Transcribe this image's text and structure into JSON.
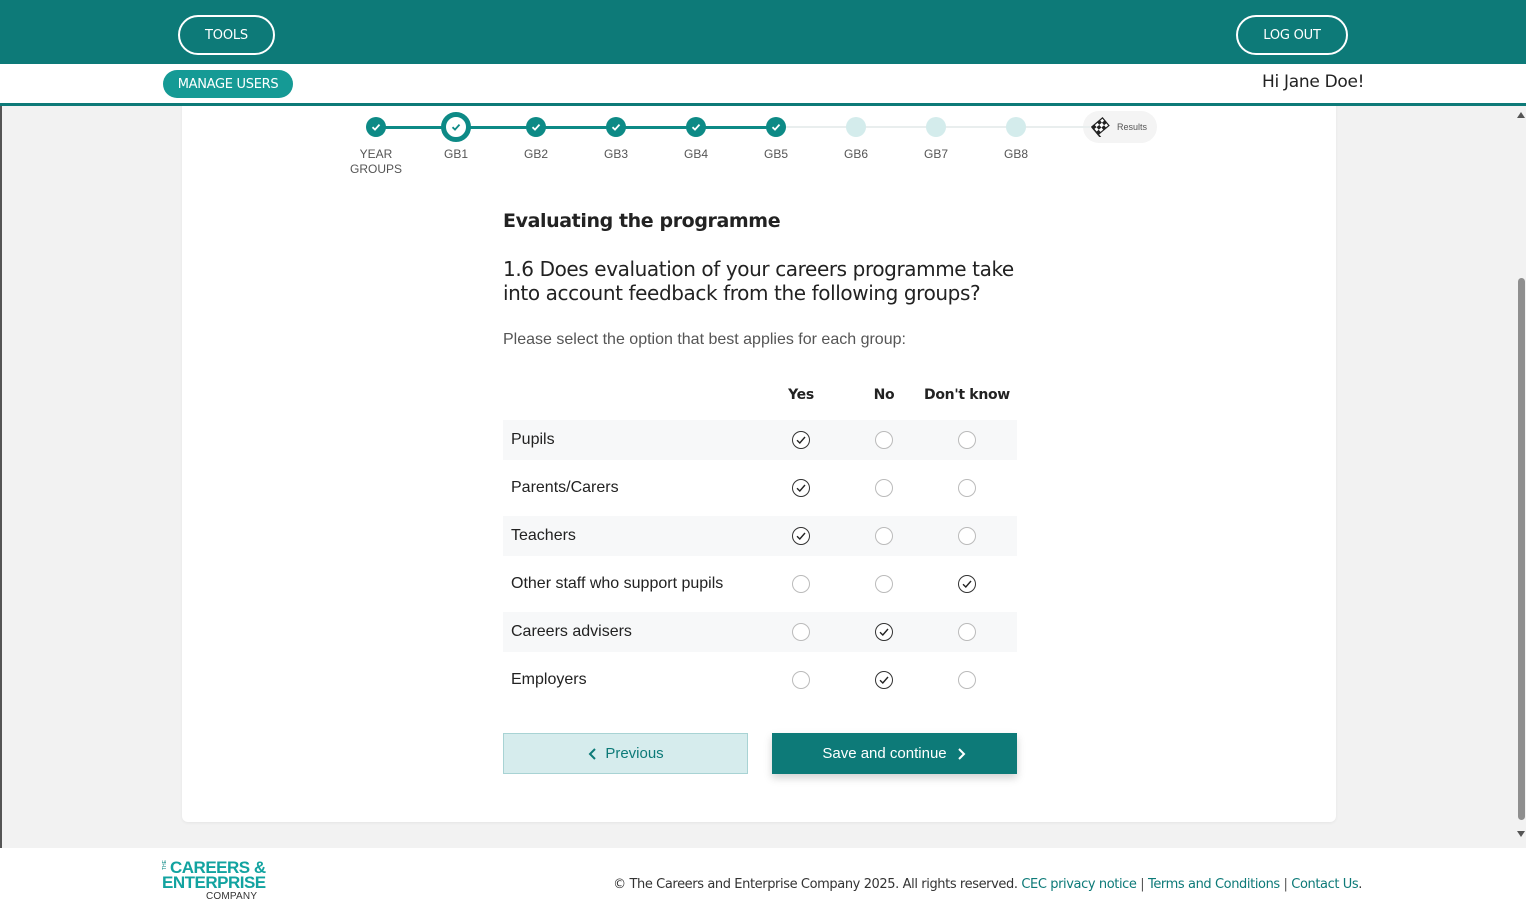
{
  "header": {
    "tools_label": "TOOLS",
    "logout_label": "LOG OUT",
    "manage_users_label": "MANAGE USERS",
    "greeting": "Hi Jane Doe!"
  },
  "stepper": {
    "steps": [
      {
        "label": "YEAR GROUPS",
        "state": "done"
      },
      {
        "label": "GB1",
        "state": "current"
      },
      {
        "label": "GB2",
        "state": "done"
      },
      {
        "label": "GB3",
        "state": "done"
      },
      {
        "label": "GB4",
        "state": "done"
      },
      {
        "label": "GB5",
        "state": "done"
      },
      {
        "label": "GB6",
        "state": "todo"
      },
      {
        "label": "GB7",
        "state": "todo"
      },
      {
        "label": "GB8",
        "state": "todo"
      }
    ],
    "results_label": "Results"
  },
  "content": {
    "section_title": "Evaluating the programme",
    "question": "1.6 Does evaluation of your careers programme take into account feedback from the following groups?",
    "instruction": "Please select the option that best applies for each group:",
    "columns": [
      "Yes",
      "No",
      "Don't know"
    ],
    "rows": [
      {
        "label": "Pupils",
        "selected": "Yes"
      },
      {
        "label": "Parents/Carers",
        "selected": "Yes"
      },
      {
        "label": "Teachers",
        "selected": "Yes"
      },
      {
        "label": "Other staff who support pupils",
        "selected": "Don't know"
      },
      {
        "label": "Careers advisers",
        "selected": "No"
      },
      {
        "label": "Employers",
        "selected": "No"
      }
    ],
    "previous_label": "Previous",
    "save_label": "Save and continue"
  },
  "footer": {
    "logo_the": "THE",
    "logo_line1": "CAREERS &",
    "logo_line2": "ENTERPRISE",
    "logo_line3": "COMPANY",
    "copyright": "© The Careers and Enterprise Company 2025. All rights reserved.",
    "privacy_link": "CEC privacy notice",
    "terms_link": "Terms and Conditions",
    "contact_link": "Contact Us",
    "separator": "|"
  },
  "colors": {
    "brand_teal": "#0d7a78",
    "accent_teal": "#159a95",
    "step_todo": "#d4ecec"
  }
}
